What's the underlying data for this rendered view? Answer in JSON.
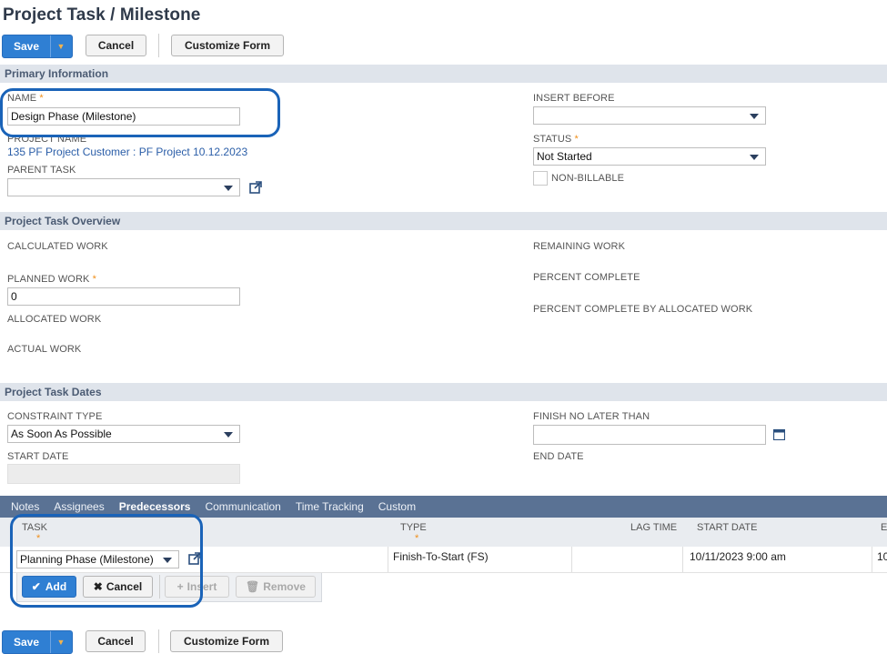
{
  "page": {
    "title": "Project Task / Milestone"
  },
  "toolbar": {
    "save_label": "Save",
    "cancel_label": "Cancel",
    "customize_label": "Customize Form"
  },
  "sections": {
    "primary": "Primary Information",
    "overview": "Project Task Overview",
    "dates": "Project Task Dates"
  },
  "primary": {
    "name_label": "NAME",
    "name_value": "Design Phase (Milestone)",
    "project_name_label": "PROJECT NAME",
    "project_name_value": "135 PF Project Customer : PF Project 10.12.2023",
    "parent_task_label": "PARENT TASK",
    "parent_task_value": "",
    "insert_before_label": "INSERT BEFORE",
    "insert_before_value": "",
    "status_label": "STATUS",
    "status_value": "Not Started",
    "non_billable_label": "NON-BILLABLE"
  },
  "overview": {
    "calculated_work_label": "CALCULATED WORK",
    "planned_work_label": "PLANNED WORK",
    "planned_work_value": "0",
    "allocated_work_label": "ALLOCATED WORK",
    "actual_work_label": "ACTUAL WORK",
    "remaining_work_label": "REMAINING WORK",
    "percent_complete_label": "PERCENT COMPLETE",
    "percent_complete_alloc_label": "PERCENT COMPLETE BY ALLOCATED WORK"
  },
  "dates": {
    "constraint_type_label": "CONSTRAINT TYPE",
    "constraint_type_value": "As Soon As Possible",
    "start_date_label": "START DATE",
    "finish_no_later_label": "FINISH NO LATER THAN",
    "end_date_label": "END DATE"
  },
  "subtabs": [
    "Notes",
    "Assignees",
    "Predecessors",
    "Communication",
    "Time Tracking",
    "Custom"
  ],
  "predecessors": {
    "columns": {
      "task": "TASK",
      "type": "TYPE",
      "lag_time": "LAG TIME",
      "start_date": "START DATE",
      "end_date_trunc": "E"
    },
    "row": {
      "task": "Planning Phase (Milestone)",
      "type": "Finish-To-Start (FS)",
      "lag_time": "",
      "start_date": "10/11/2023 9:00 am",
      "end_date_trunc": "10"
    },
    "buttons": {
      "add": "Add",
      "cancel": "Cancel",
      "insert": "Insert",
      "remove": "Remove"
    }
  },
  "colors": {
    "accent": "#2f7fd3",
    "highlight": "#1a63b8",
    "required": "#f08f1a",
    "section_bg": "#dfe4eb",
    "tabbar_bg": "#5a7294"
  }
}
